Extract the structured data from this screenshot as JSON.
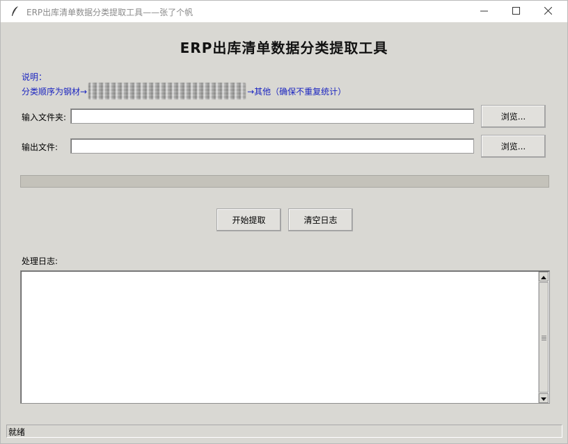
{
  "window": {
    "title": "ERP出库清单数据分类提取工具——张了个帆",
    "icons": {
      "app": "feather-icon",
      "minimize": "minimize-icon",
      "maximize": "maximize-icon",
      "close": "close-icon"
    }
  },
  "heading": "ERP出库清单数据分类提取工具",
  "description": {
    "line1": "说明：",
    "line2_prefix": "分类顺序为钢材→",
    "line2_suffix": "→其他（确保不重复统计）"
  },
  "input_folder": {
    "label": "输入文件夹:",
    "value": "",
    "browse_label": "浏览..."
  },
  "output_file": {
    "label": "输出文件:",
    "value": "",
    "browse_label": "浏览..."
  },
  "progress": {
    "value": 0
  },
  "actions": {
    "start_label": "开始提取",
    "clear_label": "清空日志"
  },
  "log": {
    "label": "处理日志:",
    "content": ""
  },
  "statusbar": {
    "text": "就绪"
  }
}
